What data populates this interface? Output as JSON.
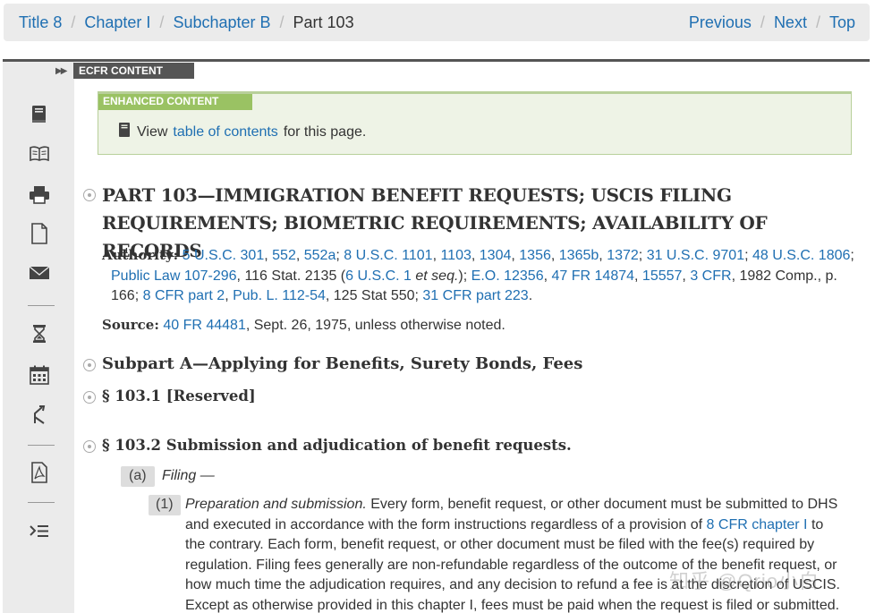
{
  "breadcrumb": {
    "items": [
      "Title 8",
      "Chapter I",
      "Subchapter B"
    ],
    "current": "Part 103"
  },
  "pager": {
    "previous": "Previous",
    "next": "Next",
    "top": "Top"
  },
  "tabs": {
    "ecfr": "ECFR CONTENT",
    "enhanced": "ENHANCED CONTENT"
  },
  "enhanced": {
    "prefix": "View",
    "link": "table of contents",
    "suffix": "for this page."
  },
  "part_heading": "PART 103—IMMIGRATION BENEFIT REQUESTS; USCIS FILING REQUIREMENTS; BIOMETRIC REQUIREMENTS; AVAILABILITY OF RECORDS",
  "authority": {
    "label": "Authority:",
    "l1": "5 U.S.C. 301",
    "t1": ",",
    "l2": "552",
    "t2": ",",
    "l3": "552a",
    "t3": ";",
    "l4": "8 U.S.C. 1101",
    "t4": ",",
    "l5": "1103",
    "t5": ",",
    "l6": "1304",
    "t6": ",",
    "l7": "1356",
    "t7": ",",
    "l8": "1365b",
    "t8": ",",
    "l9": "1372",
    "t9": ";",
    "l10": "31 U.S.C. 9701",
    "t10": ";",
    "l11": "48 U.S.C. 1806",
    "t11": ";",
    "l12": "Public Law 107-296",
    "t12": ", 116 Stat. 2135 (",
    "l13": "6 U.S.C. 1",
    "t13a": "et seq.",
    "t13b": ");",
    "l14": "E.O. 12356",
    "t14": ",",
    "l15": "47 FR 14874",
    "t15": ",",
    "l16": "15557",
    "t16": ",",
    "l17": "3 CFR",
    "t17": ", 1982 Comp., p. 166;",
    "l18": "8 CFR part 2",
    "t18": ",",
    "l19": "Pub. L. 112-54",
    "t19": ", 125 Stat 550;",
    "l20": "31 CFR part 223",
    "t20": "."
  },
  "source": {
    "label": "Source:",
    "link": "40 FR 44481",
    "text": ", Sept. 26, 1975, unless otherwise noted."
  },
  "subpart_heading": "Subpart A—Applying for Benefits, Surety Bonds, Fees",
  "sec_1031": "§ 103.1 [Reserved]",
  "sec_1032": "§ 103.2 Submission and adjudication of benefit requests.",
  "para_a": {
    "num": "(a)",
    "label": "Filing —"
  },
  "para_1": {
    "num": "(1)",
    "label": "Preparation and submission.",
    "text1": "Every form, benefit request, or other document must be submitted to DHS and executed in accordance with the form instructions regardless of a provision of",
    "link": "8 CFR chapter I",
    "text2": "to the contrary. Each form, benefit request, or other document must be filed with the fee(s) required by regulation. Filing fees generally are non-refundable regardless of the outcome of the benefit request, or how much time the adjudication requires, and any decision to refund a fee is at the discretion of USCIS. Except as otherwise provided in this chapter I, fees must be paid when the request is filed or submitted."
  },
  "watermark": "知乎 @Qrio小白"
}
